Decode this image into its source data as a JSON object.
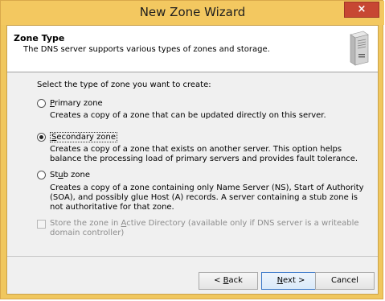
{
  "window": {
    "title": "New Zone Wizard",
    "close_glyph": "×"
  },
  "header": {
    "title": "Zone Type",
    "subtitle": "The DNS server supports various types of zones and storage.",
    "icon": "server-tower-icon"
  },
  "content": {
    "prompt": "Select the type of zone you want to create:",
    "options": [
      {
        "label": "Primary zone",
        "mnemonic": "P",
        "rest": "rimary zone",
        "selected": false,
        "description": "Creates a copy of a zone that can be updated directly on this server."
      },
      {
        "label": "Secondary zone",
        "mnemonic": "S",
        "rest": "econdary zone",
        "selected": true,
        "description": "Creates a copy of a zone that exists on another server. This option helps balance the processing load of primary servers and provides fault tolerance."
      },
      {
        "label": "Stub zone",
        "pre": "St",
        "mnemonic": "u",
        "rest": "b zone",
        "selected": false,
        "description": "Creates a copy of a zone containing only Name Server (NS), Start of Authority (SOA), and possibly glue Host (A) records. A server containing a stub zone is not authoritative for that zone."
      }
    ],
    "ad_checkbox": {
      "label": "Store the zone in Active Directory (available only if DNS server is a writeable domain controller)",
      "pre": "Store the zone in ",
      "mnemonic": "A",
      "rest": "ctive Directory (available only if DNS server is a writeable domain controller)",
      "checked": false,
      "enabled": false
    }
  },
  "buttons": {
    "back": {
      "label": "< Back",
      "pre": "< ",
      "mnemonic": "B",
      "rest": "ack"
    },
    "next": {
      "label": "Next >",
      "pre": "",
      "mnemonic": "N",
      "rest": "ext >"
    },
    "cancel": {
      "label": "Cancel"
    }
  },
  "colors": {
    "titlebar": "#f3c860",
    "close": "#c74733",
    "default_button_border": "#3a78c8"
  }
}
